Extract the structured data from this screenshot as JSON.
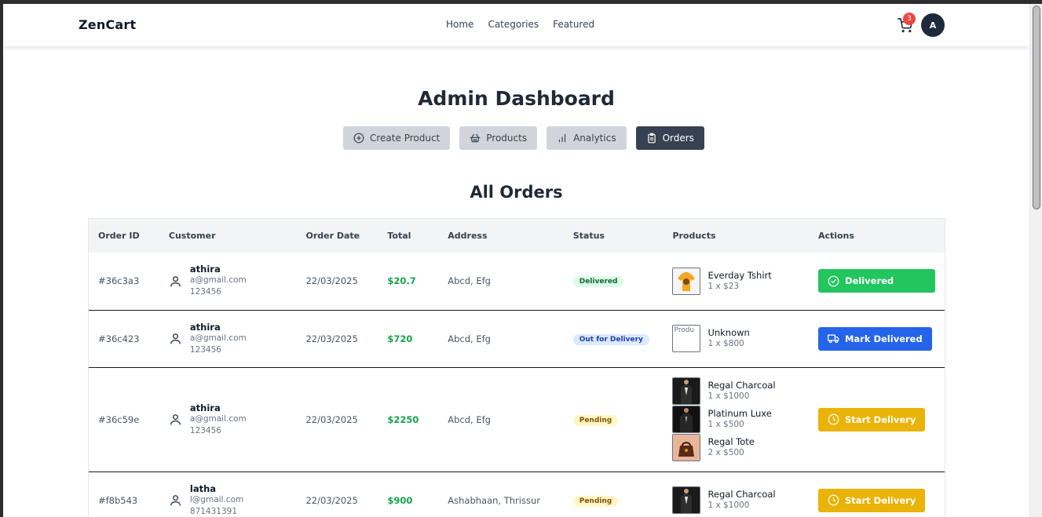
{
  "brand": "ZenCart",
  "nav": [
    "Home",
    "Categories",
    "Featured"
  ],
  "cart_count": "3",
  "avatar_initial": "A",
  "page_title": "Admin Dashboard",
  "tabs": [
    {
      "label": "Create Product",
      "icon": "plus-circle-icon",
      "active": false
    },
    {
      "label": "Products",
      "icon": "basket-icon",
      "active": false
    },
    {
      "label": "Analytics",
      "icon": "bar-chart-icon",
      "active": false
    },
    {
      "label": "Orders",
      "icon": "clipboard-icon",
      "active": true
    }
  ],
  "section_title": "All Orders",
  "columns": [
    "Order ID",
    "Customer",
    "Order Date",
    "Total",
    "Address",
    "Status",
    "Products",
    "Actions"
  ],
  "orders": [
    {
      "id": "#36c3a3",
      "name": "athira",
      "email": "a@gmail.com",
      "phone": "123456",
      "date": "22/03/2025",
      "total": "$20.7",
      "address": "Abcd, Efg",
      "status": "Delivered",
      "products": [
        {
          "name": "Everday Tshirt",
          "qty": "1 x $23"
        }
      ],
      "action": "Delivered"
    },
    {
      "id": "#36c423",
      "name": "athira",
      "email": "a@gmail.com",
      "phone": "123456",
      "date": "22/03/2025",
      "total": "$720",
      "address": "Abcd, Efg",
      "status": "Out for Delivery",
      "products": [
        {
          "name": "Unknown",
          "qty": "1 x $800",
          "alt": "Produ"
        }
      ],
      "action": "Mark Delivered"
    },
    {
      "id": "#36c59e",
      "name": "athira",
      "email": "a@gmail.com",
      "phone": "123456",
      "date": "22/03/2025",
      "total": "$2250",
      "address": "Abcd, Efg",
      "status": "Pending",
      "products": [
        {
          "name": "Regal Charcoal",
          "qty": "1 x $1000"
        },
        {
          "name": "Platinum Luxe",
          "qty": "1 x $500"
        },
        {
          "name": "Regal Tote",
          "qty": "2 x $500"
        }
      ],
      "action": "Start Delivery"
    },
    {
      "id": "#f8b543",
      "name": "latha",
      "email": "l@gmail.com",
      "phone": "871431391",
      "date": "22/03/2025",
      "total": "$900",
      "address": "Ashabhaan, Thrissur",
      "status": "Pending",
      "products": [
        {
          "name": "Regal Charcoal",
          "qty": "1 x $1000"
        }
      ],
      "action": "Start Delivery"
    }
  ],
  "colors": {
    "accent_dark": "#374151",
    "success": "#22c55e",
    "primary": "#2563eb",
    "warning": "#eab308",
    "total_text": "#16a34a"
  }
}
